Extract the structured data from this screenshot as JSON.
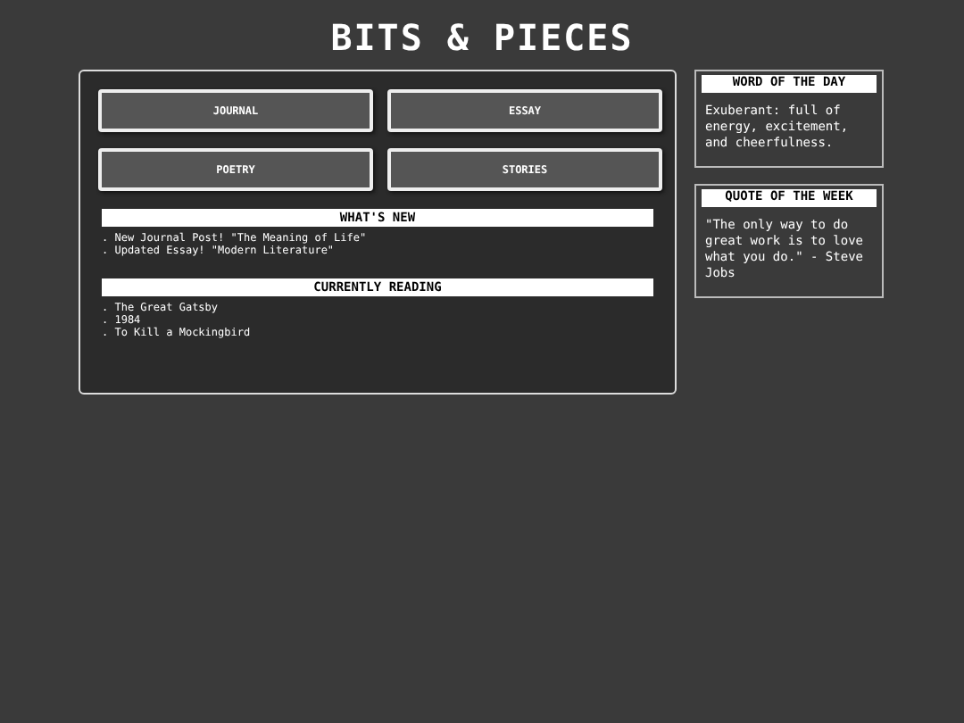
{
  "title": "BITS & PIECES",
  "nav": [
    "JOURNAL",
    "ESSAY",
    "POETRY",
    "STORIES"
  ],
  "sections": [
    {
      "heading": "WHAT'S NEW",
      "items": [
        ". New Journal Post! \"The Meaning of Life\"",
        ". Updated Essay! \"Modern Literature\""
      ]
    },
    {
      "heading": "CURRENTLY READING",
      "items": [
        ". The Great Gatsby",
        ". 1984",
        ". To Kill a Mockingbird"
      ]
    }
  ],
  "sidebar": [
    {
      "heading": "WORD OF THE DAY",
      "text": "Exuberant: full of energy, excitement, and cheerfulness."
    },
    {
      "heading": "QUOTE OF THE WEEK",
      "text": "\"The only way to do great work is to love what you do.\" - Steve Jobs"
    }
  ]
}
